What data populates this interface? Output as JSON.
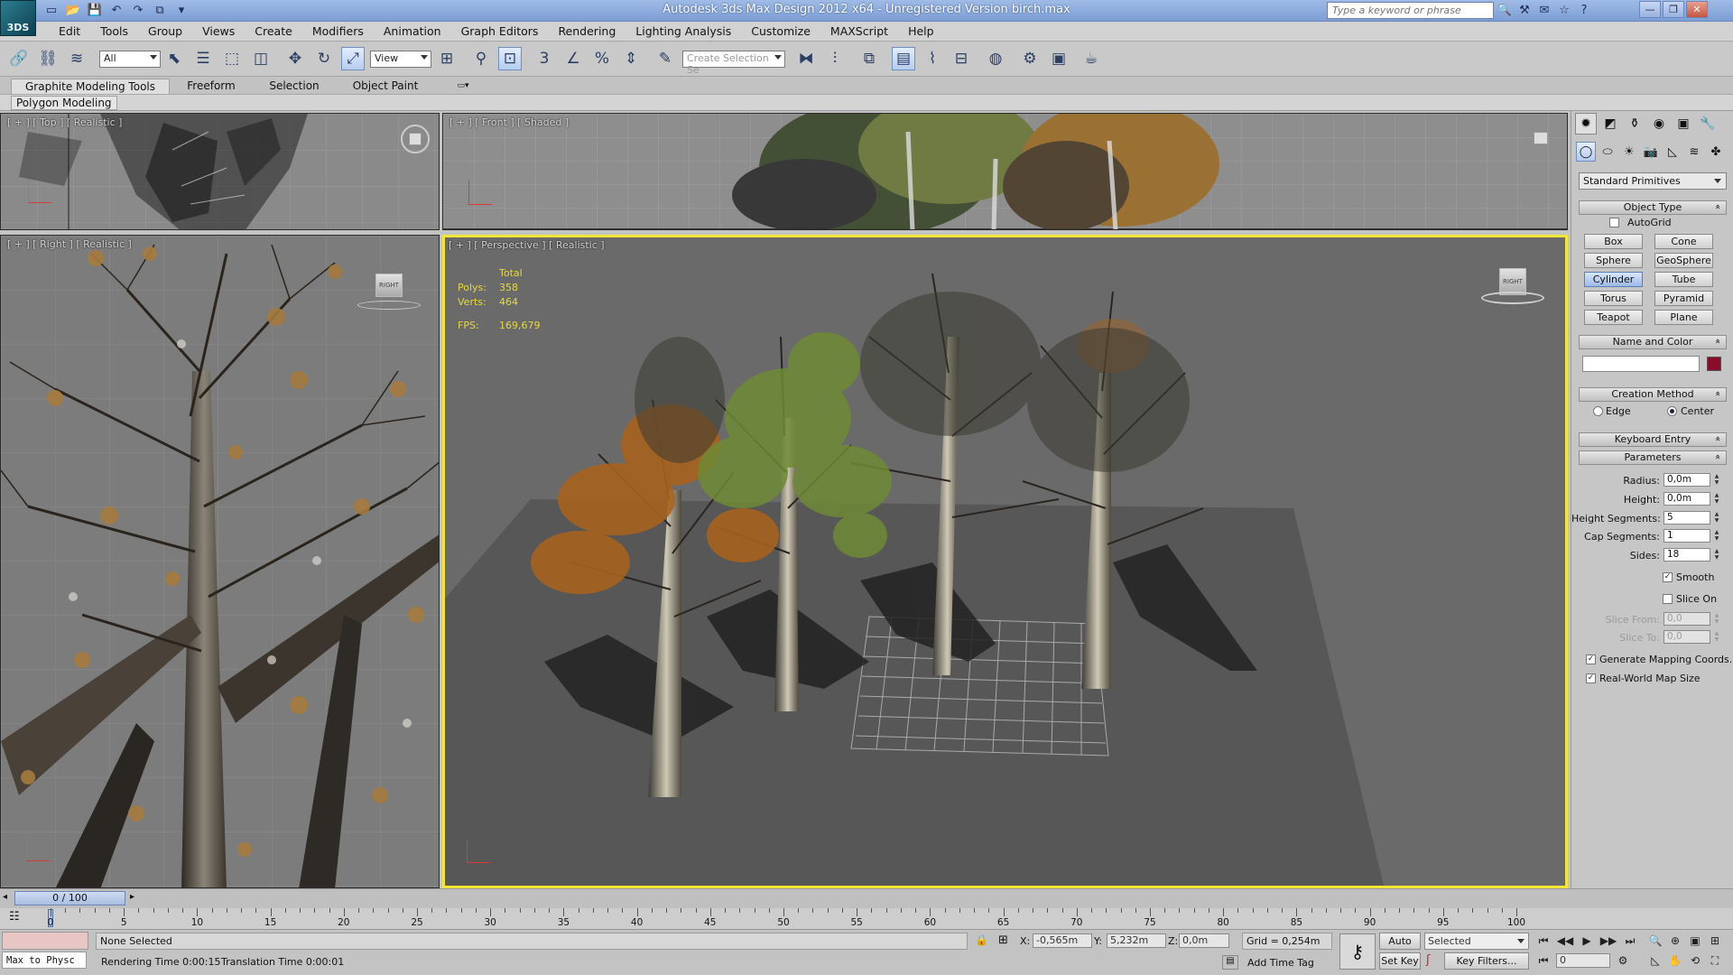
{
  "titlebar": {
    "logo": "3DS",
    "title": "Autodesk 3ds Max Design 2012 x64  -  Unregistered Version   birch.max",
    "search_placeholder": "Type a keyword or phrase"
  },
  "menu": [
    "Edit",
    "Tools",
    "Group",
    "Views",
    "Create",
    "Modifiers",
    "Animation",
    "Graph Editors",
    "Rendering",
    "Lighting Analysis",
    "Customize",
    "MAXScript",
    "Help"
  ],
  "toolbar": {
    "filter_value": "All",
    "refcoord_value": "View",
    "selection_set_placeholder": "Create Selection Se",
    "snap_label": "3",
    "angle_label": "∠",
    "percent_label": "%"
  },
  "ribbon": {
    "tabs": [
      "Graphite Modeling Tools",
      "Freeform",
      "Selection",
      "Object Paint"
    ],
    "sub": "Polygon Modeling"
  },
  "viewports": {
    "top_label": "[ + ] [ Top ] [ Realistic ]",
    "front_label": "[ + ] [ Front ] [ Shaded ]",
    "right_label": "[ + ] [ Right ] [ Realistic ]",
    "persp_label": "[ + ] [ Perspective ] [ Realistic ]",
    "viewcube_right": "RIGHT",
    "stats": {
      "total_label": "Total",
      "polys_label": "Polys:",
      "polys_value": "358",
      "verts_label": "Verts:",
      "verts_value": "464",
      "fps_label": "FPS:",
      "fps_value": "169,679"
    }
  },
  "command_panel": {
    "primitive_type": "Standard Primitives",
    "object_type_title": "Object Type",
    "autogrid_label": "AutoGrid",
    "objects": [
      "Box",
      "Cone",
      "Sphere",
      "GeoSphere",
      "Cylinder",
      "Tube",
      "Torus",
      "Pyramid",
      "Teapot",
      "Plane"
    ],
    "active_object": "Cylinder",
    "name_color_title": "Name and Color",
    "name_value": "",
    "object_color": "#8a0b2a",
    "creation_method_title": "Creation Method",
    "edge_label": "Edge",
    "center_label": "Center",
    "keyboard_entry_title": "Keyboard Entry",
    "parameters_title": "Parameters",
    "params": {
      "radius_label": "Radius:",
      "radius_value": "0,0m",
      "height_label": "Height:",
      "height_value": "0,0m",
      "height_segs_label": "Height Segments:",
      "height_segs_value": "5",
      "cap_segs_label": "Cap Segments:",
      "cap_segs_value": "1",
      "sides_label": "Sides:",
      "sides_value": "18",
      "smooth_label": "Smooth",
      "slice_on_label": "Slice On",
      "slice_from_label": "Slice From:",
      "slice_from_value": "0,0",
      "slice_to_label": "Slice To:",
      "slice_to_value": "0,0",
      "gen_mapping_label": "Generate Mapping Coords.",
      "real_world_label": "Real-World Map Size"
    }
  },
  "timeline": {
    "slider_label": "0 / 100",
    "ticks": [
      "0",
      "5",
      "10",
      "15",
      "20",
      "25",
      "30",
      "35",
      "40",
      "45",
      "50",
      "55",
      "60",
      "65",
      "70",
      "75",
      "80",
      "85",
      "90",
      "95",
      "100"
    ]
  },
  "status": {
    "listener_text": "Max to Physc",
    "selection_status": "None Selected",
    "rendering_time": "Rendering Time  0:00:15",
    "translation_time": "Translation Time  0:00:01",
    "x_label": "X:",
    "x_value": "-0,565m",
    "y_label": "Y:",
    "y_value": "5,232m",
    "z_label": "Z:",
    "z_value": "0,0m",
    "grid": "Grid = 0,254m",
    "add_time_tag": "Add Time Tag",
    "auto_key": "Auto Key",
    "set_key": "Set Key",
    "key_mode": "Selected",
    "key_filters": "Key Filters...",
    "frame_value": "0"
  }
}
